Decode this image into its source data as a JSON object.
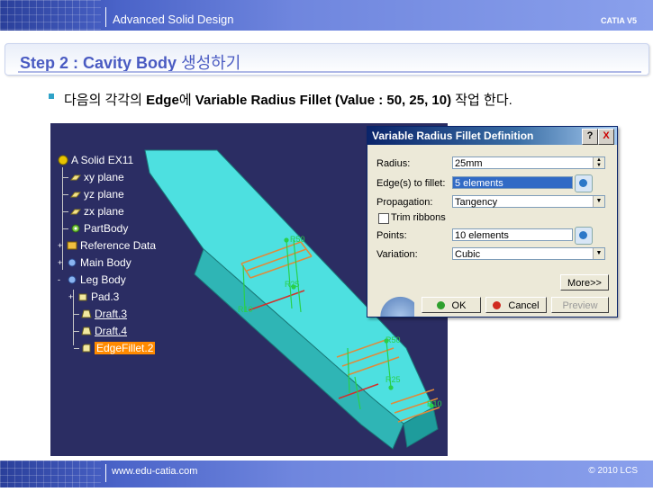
{
  "header": {
    "title": "Advanced Solid Design",
    "brand": "CATIA V5"
  },
  "slide": {
    "title_en": "Step 2 : Cavity Body",
    "title_ko": "생성하기",
    "bullet": {
      "prefix": "다음의 각각의 ",
      "bold1": "Edge",
      "mid": "에 ",
      "bold2": "Variable Radius Fillet (Value : 50, 25, 10)",
      "suffix": " 작업 한다."
    }
  },
  "tree": {
    "items": [
      {
        "label": "A Solid EX11",
        "icon": "part-icon"
      },
      {
        "label": "xy plane",
        "prefix": "xy",
        "icon": "plane-icon"
      },
      {
        "label": "yz plane",
        "prefix": "yz",
        "icon": "plane-icon"
      },
      {
        "label": "zx plane",
        "prefix": "zx",
        "icon": "plane-icon"
      },
      {
        "label": "PartBody",
        "icon": "gear-icon"
      },
      {
        "label": "Reference Data",
        "icon": "reference-icon"
      },
      {
        "label": "Main Body",
        "icon": "body-icon"
      },
      {
        "label": "Leg Body",
        "icon": "body-icon"
      },
      {
        "label": "Pad.3",
        "icon": "pad-icon"
      },
      {
        "label": "Draft.3",
        "icon": "draft-icon"
      },
      {
        "label": "Draft.4",
        "icon": "draft-icon"
      },
      {
        "label": "EdgeFillet.2",
        "icon": "fillet-icon"
      }
    ]
  },
  "viewport_labels": {
    "r50_a": "R50",
    "r25_a": "R25",
    "r10_a": "R10",
    "r50_b": "R50",
    "r25_b": "R25",
    "r10_b": "R10"
  },
  "dialog": {
    "title": "Variable Radius Fillet Definition",
    "help": "?",
    "close": "X",
    "radius_label": "Radius:",
    "radius_value": "25mm",
    "edges_label": "Edge(s) to fillet:",
    "edges_value": "5 elements",
    "propagation_label": "Propagation:",
    "propagation_value": "Tangency",
    "trim_label": "Trim ribbons",
    "points_label": "Points:",
    "points_value": "10 elements",
    "variation_label": "Variation:",
    "variation_value": "Cubic",
    "more": "More>>",
    "ok": "OK",
    "cancel": "Cancel",
    "preview": "Preview"
  },
  "footer": {
    "url": "www.edu-catia.com",
    "copyright": "© 2010 LCS"
  },
  "colors": {
    "accent": "#4a5bc2",
    "viewport_bg": "#2b2d63",
    "solid": "#3fd6d6",
    "selection": "#ff8a00"
  }
}
